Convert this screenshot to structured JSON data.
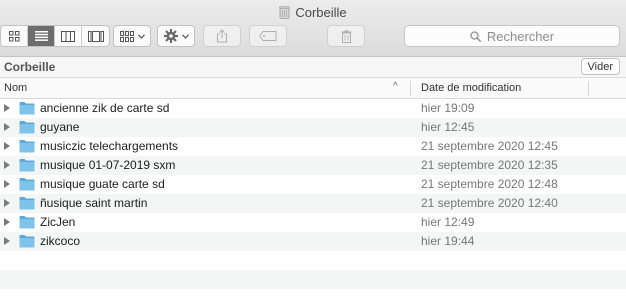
{
  "window": {
    "title": "Corbeille"
  },
  "toolbar": {
    "view_modes": [
      "icon-view",
      "list-view",
      "column-view",
      "gallery-view"
    ],
    "active_view": "list-view",
    "search_placeholder": "Rechercher"
  },
  "pathbar": {
    "location": "Corbeille",
    "empty_label": "Vider"
  },
  "columns": {
    "name": "Nom",
    "date": "Date de modification"
  },
  "files": [
    {
      "name": "ancienne zik de carte sd",
      "date": "hier 19:09"
    },
    {
      "name": "guyane",
      "date": "hier 12:45"
    },
    {
      "name": "musiczic telechargements",
      "date": "21 septembre 2020 12:45"
    },
    {
      "name": "musique 01-07-2019 sxm",
      "date": "21 septembre 2020 12:35"
    },
    {
      "name": "musique guate carte sd",
      "date": "21 septembre 2020 12:48"
    },
    {
      "name": "ñusique saint martin",
      "date": "21 septembre 2020 12:40"
    },
    {
      "name": "ZicJen",
      "date": "hier 12:49"
    },
    {
      "name": "zikcoco",
      "date": "hier 19:44"
    }
  ],
  "colors": {
    "folder": "#7ec3ea",
    "folder_dark": "#5aa9d8",
    "active_segment": "#6d6d6d"
  }
}
